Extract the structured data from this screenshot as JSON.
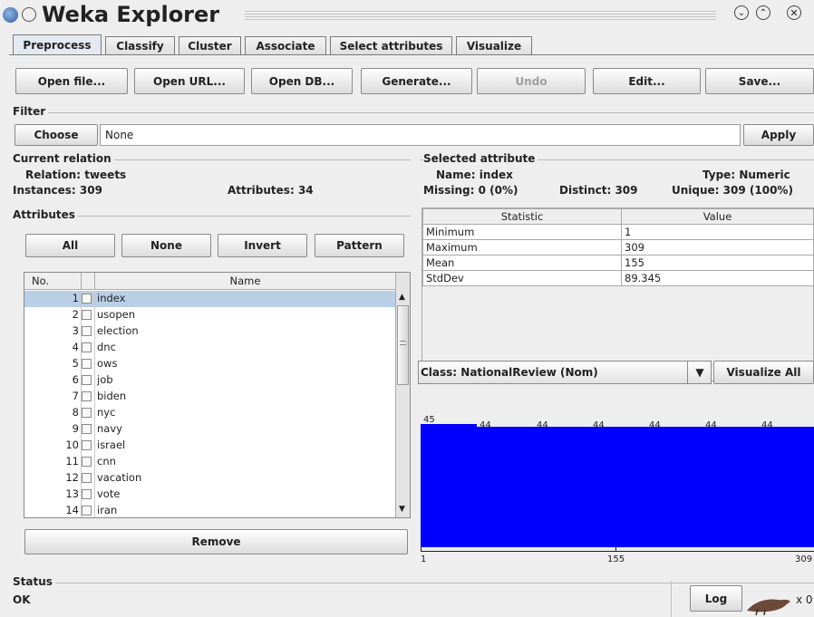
{
  "window": {
    "title": "Weka Explorer"
  },
  "tabs": [
    "Preprocess",
    "Classify",
    "Cluster",
    "Associate",
    "Select attributes",
    "Visualize"
  ],
  "toolbar": {
    "open_file": "Open file...",
    "open_url": "Open URL...",
    "open_db": "Open DB...",
    "generate": "Generate...",
    "undo": "Undo",
    "edit": "Edit...",
    "save": "Save..."
  },
  "filter": {
    "title": "Filter",
    "choose": "Choose",
    "value": "None",
    "apply": "Apply"
  },
  "relation": {
    "title": "Current relation",
    "relation_label": "Relation:",
    "relation_value": "tweets",
    "instances_label": "Instances:",
    "instances_value": "309",
    "attributes_label": "Attributes:",
    "attributes_value": "34"
  },
  "attributes": {
    "title": "Attributes",
    "buttons": {
      "all": "All",
      "none": "None",
      "invert": "Invert",
      "pattern": "Pattern"
    },
    "col_no": "No.",
    "col_name": "Name",
    "rows": [
      {
        "no": "1",
        "name": "index"
      },
      {
        "no": "2",
        "name": "usopen"
      },
      {
        "no": "3",
        "name": "election"
      },
      {
        "no": "4",
        "name": "dnc"
      },
      {
        "no": "5",
        "name": "ows"
      },
      {
        "no": "6",
        "name": "job"
      },
      {
        "no": "7",
        "name": "biden"
      },
      {
        "no": "8",
        "name": "nyc"
      },
      {
        "no": "9",
        "name": "navy"
      },
      {
        "no": "10",
        "name": "israel"
      },
      {
        "no": "11",
        "name": "cnn"
      },
      {
        "no": "12",
        "name": "vacation"
      },
      {
        "no": "13",
        "name": "vote"
      },
      {
        "no": "14",
        "name": "iran"
      }
    ],
    "remove": "Remove"
  },
  "selected": {
    "title": "Selected attribute",
    "name_label": "Name:",
    "name_value": "index",
    "type_label": "Type:",
    "type_value": "Numeric",
    "missing_label": "Missing:",
    "missing_value": "0 (0%)",
    "distinct_label": "Distinct:",
    "distinct_value": "309",
    "unique_label": "Unique:",
    "unique_value": "309 (100%)",
    "stat_header": "Statistic",
    "value_header": "Value",
    "stats": [
      {
        "stat": "Minimum",
        "value": "1"
      },
      {
        "stat": "Maximum",
        "value": "309"
      },
      {
        "stat": "Mean",
        "value": "155"
      },
      {
        "stat": "StdDev",
        "value": "89.345"
      }
    ]
  },
  "class_select": {
    "value": "Class: NationalReview (Nom)",
    "visualize_all": "Visualize All"
  },
  "histogram": {
    "bar_color": "#0000ff",
    "counts": [
      "45",
      "44",
      "44",
      "44",
      "44",
      "44",
      "44"
    ],
    "axis_labels": [
      "1",
      "155",
      "309"
    ]
  },
  "status": {
    "title": "Status",
    "text": "OK",
    "log": "Log",
    "x_label": "x 0"
  }
}
